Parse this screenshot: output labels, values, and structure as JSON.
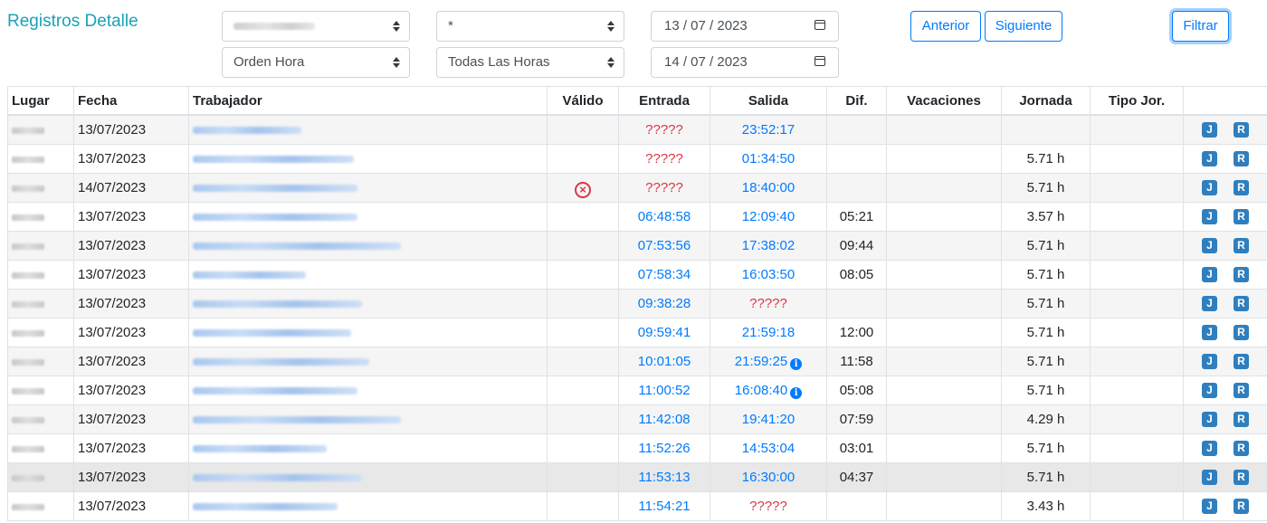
{
  "header": {
    "title": "Registros Detalle"
  },
  "filters": {
    "select_worker": "",
    "select_star": "*",
    "date_from": "13 / 07 / 2023",
    "select_order": "Orden Hora",
    "select_hours": "Todas Las Horas",
    "date_to": "14 / 07 / 2023"
  },
  "buttons": {
    "prev": "Anterior",
    "next": "Siguiente",
    "filter": "Filtrar"
  },
  "table": {
    "columns": [
      "Lugar",
      "Fecha",
      "Trabajador",
      "Válido",
      "Entrada",
      "Salida",
      "Dif.",
      "Vacaciones",
      "Jornada",
      "Tipo Jor.",
      ""
    ],
    "action_labels": {
      "j": "J",
      "r": "R"
    },
    "rows": [
      {
        "fecha": "13/07/2023",
        "valido": "",
        "entrada": "?????",
        "salida": "23:52:17",
        "dif": "",
        "vacaciones": "",
        "jornada": "",
        "tipo": ""
      },
      {
        "fecha": "13/07/2023",
        "valido": "",
        "entrada": "?????",
        "salida": "01:34:50",
        "dif": "",
        "vacaciones": "",
        "jornada": "5.71 h",
        "tipo": ""
      },
      {
        "fecha": "14/07/2023",
        "valido": "x",
        "entrada": "?????",
        "salida": "18:40:00",
        "dif": "",
        "vacaciones": "",
        "jornada": "5.71 h",
        "tipo": ""
      },
      {
        "fecha": "13/07/2023",
        "valido": "",
        "entrada": "06:48:58",
        "salida": "12:09:40",
        "dif": "05:21",
        "vacaciones": "",
        "jornada": "3.57 h",
        "tipo": ""
      },
      {
        "fecha": "13/07/2023",
        "valido": "",
        "entrada": "07:53:56",
        "salida": "17:38:02",
        "dif": "09:44",
        "vacaciones": "",
        "jornada": "5.71 h",
        "tipo": ""
      },
      {
        "fecha": "13/07/2023",
        "valido": "",
        "entrada": "07:58:34",
        "salida": "16:03:50",
        "dif": "08:05",
        "vacaciones": "",
        "jornada": "5.71 h",
        "tipo": ""
      },
      {
        "fecha": "13/07/2023",
        "valido": "",
        "entrada": "09:38:28",
        "salida": "?????",
        "dif": "",
        "vacaciones": "",
        "jornada": "5.71 h",
        "tipo": ""
      },
      {
        "fecha": "13/07/2023",
        "valido": "",
        "entrada": "09:59:41",
        "salida": "21:59:18",
        "dif": "12:00",
        "vacaciones": "",
        "jornada": "5.71 h",
        "tipo": ""
      },
      {
        "fecha": "13/07/2023",
        "valido": "",
        "entrada": "10:01:05",
        "salida": "21:59:25",
        "salida_info": true,
        "dif": "11:58",
        "vacaciones": "",
        "jornada": "5.71 h",
        "tipo": ""
      },
      {
        "fecha": "13/07/2023",
        "valido": "",
        "entrada": "11:00:52",
        "salida": "16:08:40",
        "salida_info": true,
        "dif": "05:08",
        "vacaciones": "",
        "jornada": "5.71 h",
        "tipo": ""
      },
      {
        "fecha": "13/07/2023",
        "valido": "",
        "entrada": "11:42:08",
        "salida": "19:41:20",
        "dif": "07:59",
        "vacaciones": "",
        "jornada": "4.29 h",
        "tipo": ""
      },
      {
        "fecha": "13/07/2023",
        "valido": "",
        "entrada": "11:52:26",
        "salida": "14:53:04",
        "dif": "03:01",
        "vacaciones": "",
        "jornada": "5.71 h",
        "tipo": ""
      },
      {
        "fecha": "13/07/2023",
        "valido": "",
        "entrada": "11:53:13",
        "salida": "16:30:00",
        "dif": "04:37",
        "vacaciones": "",
        "jornada": "5.71 h",
        "tipo": "",
        "hover": true
      },
      {
        "fecha": "13/07/2023",
        "valido": "",
        "entrada": "11:54:21",
        "salida": "?????",
        "dif": "",
        "vacaciones": "",
        "jornada": "3.43 h",
        "tipo": ""
      }
    ]
  },
  "colors": {
    "accent": "#007bff",
    "title": "#17a2b8",
    "missing": "#dc3545"
  }
}
